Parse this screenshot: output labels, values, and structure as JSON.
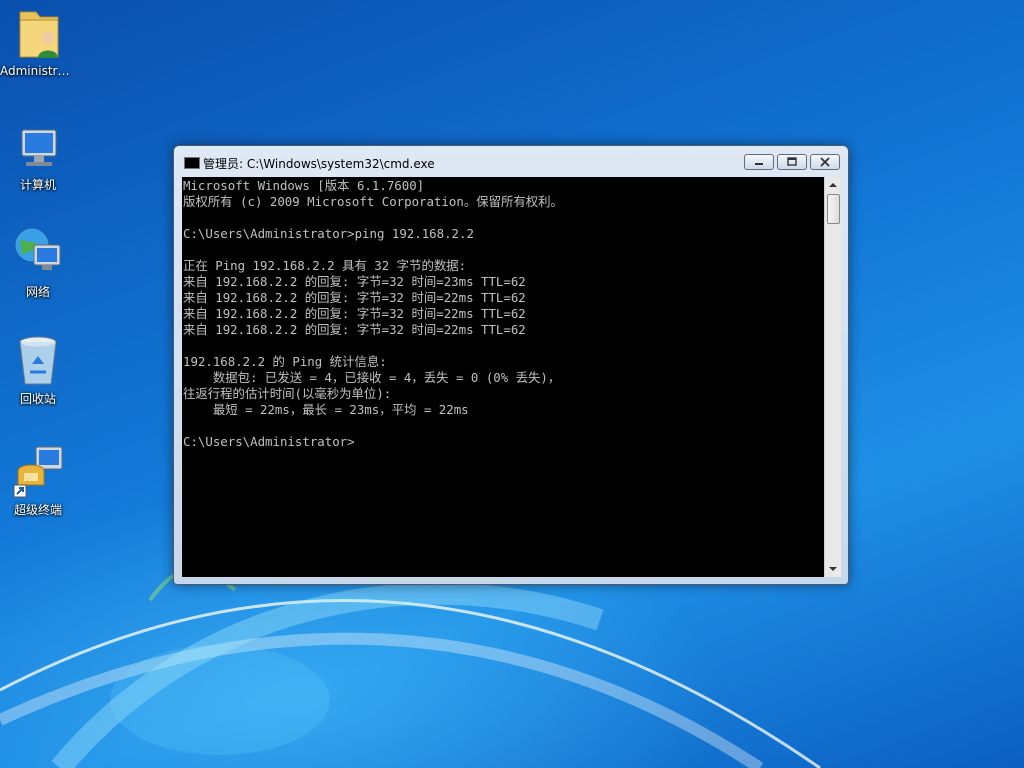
{
  "desktop": {
    "icons": [
      {
        "label": "Administra...",
        "icon": "user-folder-icon"
      },
      {
        "label": "计算机",
        "icon": "computer-icon"
      },
      {
        "label": "网络",
        "icon": "network-icon"
      },
      {
        "label": "回收站",
        "icon": "recycle-bin-icon"
      },
      {
        "label": "超级终端",
        "icon": "hyperterminal-shortcut-icon"
      }
    ],
    "accent": "#1277d6"
  },
  "window": {
    "title": "管理员: C:\\Windows\\system32\\cmd.exe",
    "buttons": {
      "minimize": "minimize-icon",
      "maximize": "maximize-icon",
      "close": "close-icon"
    }
  },
  "console": {
    "foreground": "#c0c0c0",
    "background": "#000000",
    "lines": [
      "Microsoft Windows [版本 6.1.7600]",
      "版权所有 (c) 2009 Microsoft Corporation。保留所有权利。",
      "",
      "C:\\Users\\Administrator>ping 192.168.2.2",
      "",
      "正在 Ping 192.168.2.2 具有 32 字节的数据:",
      "来自 192.168.2.2 的回复: 字节=32 时间=23ms TTL=62",
      "来自 192.168.2.2 的回复: 字节=32 时间=22ms TTL=62",
      "来自 192.168.2.2 的回复: 字节=32 时间=22ms TTL=62",
      "来自 192.168.2.2 的回复: 字节=32 时间=22ms TTL=62",
      "",
      "192.168.2.2 的 Ping 统计信息:",
      "    数据包: 已发送 = 4，已接收 = 4，丢失 = 0 (0% 丢失)，",
      "往返行程的估计时间(以毫秒为单位):",
      "    最短 = 22ms，最长 = 23ms，平均 = 22ms",
      "",
      "C:\\Users\\Administrator>"
    ]
  }
}
